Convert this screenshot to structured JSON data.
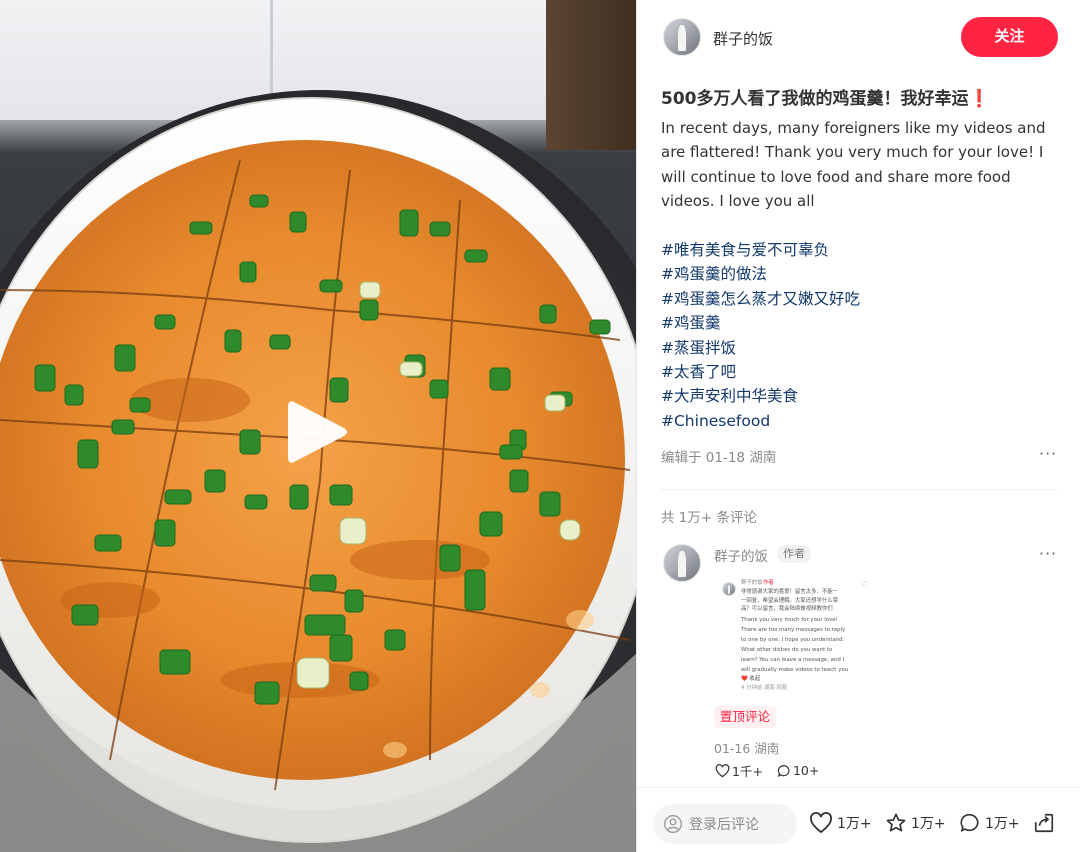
{
  "post": {
    "author": "群子的饭",
    "follow_label": "关注",
    "title": "500多万人看了我做的鸡蛋羹！我好幸运❗",
    "body": "In recent days, many foreigners like my videos and are flattered! Thank you very much for your love! I will continue to love food and share more food videos. I love you all",
    "hashtags": [
      "#唯有美食与爱不可辜负",
      "#鸡蛋羹的做法",
      "#鸡蛋羹怎么蒸才又嫩又好吃",
      "#鸡蛋羹",
      "#蒸蛋拌饭",
      "#太香了吧",
      "#大声安利中华美食",
      "#Chinesefood"
    ],
    "edit_info": "编辑于 01-18 湖南",
    "more": "···"
  },
  "comments": {
    "count_label": "共 1万+ 条评论",
    "pinned": {
      "author": "群子的饭",
      "badge": "作者",
      "more": "···",
      "image_text": {
        "author": "群子的饭",
        "badge": "作者",
        "lines": [
          "非常感谢大家的喜爱！留言太多，不能一",
          "一回复，希望会理解。大家还想学什么菜",
          "品？可以留言，我会陆续做视频教你们",
          "Thank you very much for your love!",
          "There are too many messages to reply",
          "to one by one. I hope you understand.",
          "What other dishes do you want to",
          "learn? You can leave a message, and I",
          "will gradually make videos to teach you",
          "❤️ 收起"
        ],
        "footer": "4 分钟前  湖南  回复"
      },
      "pinned_label": "置顶评论",
      "meta": "01-16 湖南",
      "likes": "1千+",
      "replies": "10+"
    }
  },
  "bottom_bar": {
    "input_placeholder": "登录后评论",
    "likes": "1万+",
    "collects": "1万+",
    "comments": "1万+"
  },
  "colors": {
    "accent": "#ff2442",
    "hashtag": "#13386c",
    "muted": "#8a8a8a"
  },
  "icons": {
    "play": "play-icon",
    "user": "user-icon",
    "heart": "heart-icon",
    "star": "star-icon",
    "comment": "comment-bubble-icon",
    "share": "share-icon"
  }
}
